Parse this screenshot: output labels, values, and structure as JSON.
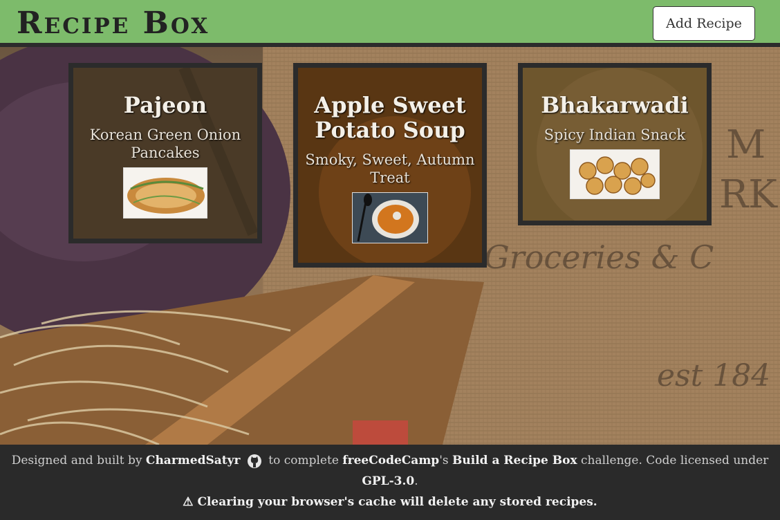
{
  "header": {
    "title": "Recipe Box",
    "add_button_label": "Add Recipe"
  },
  "recipes": [
    {
      "name": "Pajeon",
      "description": "Korean Green Onion Pancakes",
      "image_icon": "pajeon-photo"
    },
    {
      "name": "Apple Sweet Potato Soup",
      "description": "Smoky, Sweet, Autumn Treat",
      "image_icon": "soup-photo"
    },
    {
      "name": "Bhakarwadi",
      "description": "Spicy Indian Snack",
      "image_icon": "bhakarwadi-photo"
    }
  ],
  "footer": {
    "designed_by_prefix": "Designed and built by",
    "author": "CharmedSatyr",
    "to_complete": "to complete",
    "fcc": "freeCodeCamp",
    "possessive": "'s",
    "challenge": "Build a Recipe Box",
    "challenge_suffix": "challenge. Code licensed under",
    "license": "GPL-3.0",
    "period": ".",
    "warning_icon": "⚠",
    "warning": "Clearing your browser's cache will delete any stored recipes."
  },
  "colors": {
    "header_bg": "#7dbb6b",
    "footer_bg": "#2a2a2a",
    "card_border": "#2b2b2b"
  }
}
